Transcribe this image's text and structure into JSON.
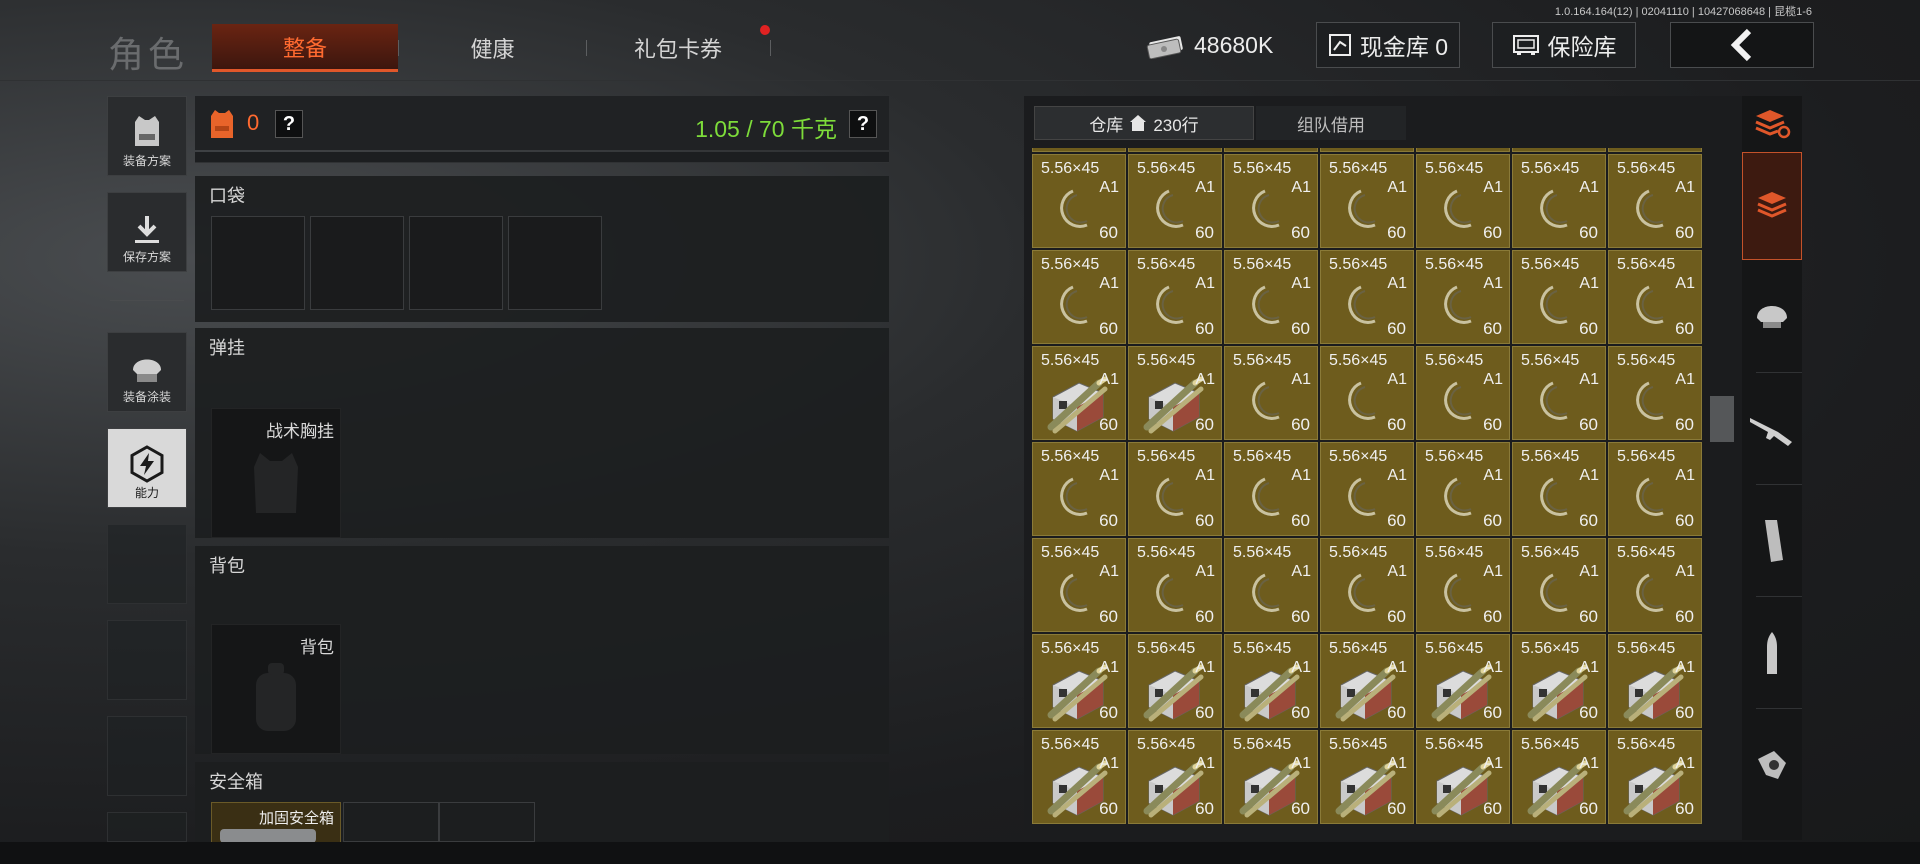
{
  "version": "1.0.164.164(12) | 02041110 | 10427068648 | 昆榄1-6",
  "header": {
    "title": "角色",
    "tabs": [
      {
        "label": "整备",
        "active": true
      },
      {
        "label": "健康",
        "active": false
      },
      {
        "label": "礼包卡券",
        "active": false,
        "badge": "red-dot"
      }
    ],
    "money": "48680K",
    "cash_label": "现金库 0",
    "safe_label": "保险库",
    "back_icon": "chevron-left-icon"
  },
  "sidebar": {
    "items": [
      {
        "label": "装备方案",
        "icon": "vest-icon"
      },
      {
        "label": "保存方案",
        "icon": "download-icon"
      },
      {
        "label": "装备涂装",
        "icon": "helmet-icon"
      },
      {
        "label": "能力",
        "icon": "lightning-hex-icon",
        "active": true
      }
    ]
  },
  "equipment": {
    "armor_count": "0",
    "help": "?",
    "weight": "1.05 / 70 千克",
    "pockets_title": "口袋",
    "rig_title": "弹挂",
    "rig_item": "战术胸挂",
    "backpack_title": "背包",
    "backpack_item": "背包",
    "safebox_title": "安全箱",
    "safebox_item": "加固安全箱"
  },
  "warehouse": {
    "tab_label": "仓库",
    "rows": "230行",
    "team_tab": "组队借用",
    "item_caliber": "5.56×45",
    "item_variant": "A1",
    "item_count": "60",
    "grid_rows": [
      [
        "mag",
        "mag",
        "mag",
        "mag",
        "mag",
        "mag",
        "mag"
      ],
      [
        "mag",
        "mag",
        "mag",
        "mag",
        "mag",
        "mag",
        "mag"
      ],
      [
        "box",
        "box",
        "mag",
        "mag",
        "mag",
        "mag",
        "mag"
      ],
      [
        "mag",
        "mag",
        "mag",
        "mag",
        "mag",
        "mag",
        "mag"
      ],
      [
        "mag",
        "mag",
        "mag",
        "mag",
        "mag",
        "mag",
        "mag"
      ],
      [
        "box",
        "box",
        "box",
        "box",
        "box",
        "box",
        "box"
      ],
      [
        "box",
        "box",
        "box",
        "box",
        "box",
        "box",
        "box"
      ]
    ]
  },
  "categories": [
    "stack-refresh-icon",
    "stack-icon",
    "helmet-icon",
    "rifle-icon",
    "magazine-icon",
    "bullet-icon",
    "scope-icon"
  ],
  "colors": {
    "accent": "#e0572a",
    "weight_green": "#7ddc3a",
    "cell_gold": "#6e5c1d"
  }
}
